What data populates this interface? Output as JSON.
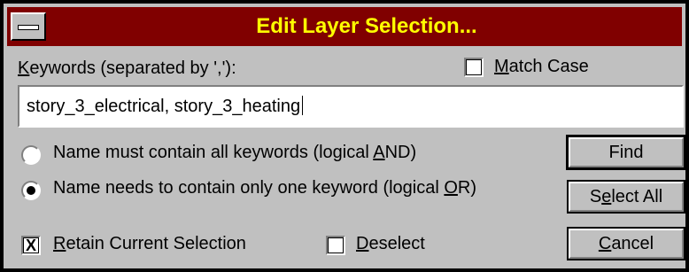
{
  "window": {
    "title": "Edit Layer Selection..."
  },
  "keywords": {
    "label": "Keywords (separated by ',')",
    "label_key": "K",
    "label_rest": "eywords (separated by ',')",
    "value": "story_3_electrical, story_3_heating"
  },
  "match_case": {
    "label_key": "M",
    "label_rest": "atch Case",
    "checked": false
  },
  "options": {
    "and_label_pre": "Name must contain all keywords (logical ",
    "and_label_key": "A",
    "and_label_post": "ND)",
    "or_label_pre": "Name needs to contain only one keyword (logical ",
    "or_label_key": "O",
    "or_label_post": "R)",
    "selected": "or"
  },
  "retain": {
    "label_key": "R",
    "label_rest": "etain Current Selection",
    "checked": true,
    "mark": "X"
  },
  "deselect": {
    "label_key": "D",
    "label_rest": "eselect",
    "checked": false
  },
  "buttons": {
    "find": "Find",
    "select_all_pre": "S",
    "select_all_key": "e",
    "select_all_post": "lect All",
    "cancel_key": "C",
    "cancel_rest": "ancel"
  }
}
